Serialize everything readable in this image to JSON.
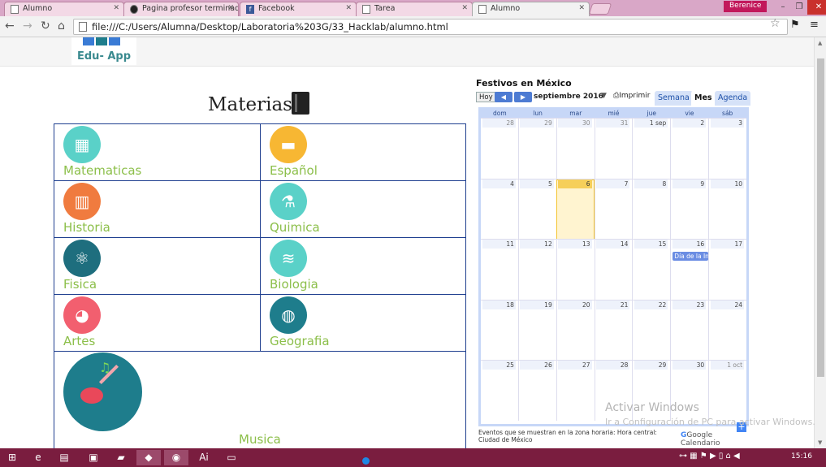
{
  "browser": {
    "tabs": [
      {
        "label": "Alumno",
        "active": false
      },
      {
        "label": "Pagina profesor terminad",
        "active": false
      },
      {
        "label": "Facebook",
        "active": false
      },
      {
        "label": "Tarea",
        "active": false
      },
      {
        "label": "Alumno",
        "active": true
      }
    ],
    "user": "Berenice",
    "url": "file:///C:/Users/Alumna/Desktop/Laboratoria%203G/33_Hacklab/alumno.html"
  },
  "header": {
    "logo_text": "Edu- App"
  },
  "materias": {
    "title": "Materias",
    "items": [
      {
        "label": "Matematicas",
        "icon": "calculator-icon",
        "color": "#5ad1c8",
        "symbol": "▦"
      },
      {
        "label": "Español",
        "icon": "book-stack-icon",
        "color": "#f7b733",
        "symbol": "▬"
      },
      {
        "label": "Historia",
        "icon": "column-icon",
        "color": "#f07b3f",
        "symbol": "▥"
      },
      {
        "label": "Quimica",
        "icon": "flask-icon",
        "color": "#5ad1c8",
        "symbol": "⚗"
      },
      {
        "label": "Fisica",
        "icon": "atom-icon",
        "color": "#1e6e7e",
        "symbol": "⚛"
      },
      {
        "label": "Biologia",
        "icon": "dna-icon",
        "color": "#5ad1c8",
        "symbol": "≋"
      },
      {
        "label": "Artes",
        "icon": "palette-icon",
        "color": "#f25f6f",
        "symbol": "◕"
      },
      {
        "label": "Geografia",
        "icon": "globe-icon",
        "color": "#1e7d8c",
        "symbol": "◍"
      }
    ],
    "music": {
      "label": "Musica",
      "icon": "guitar-icon",
      "note": "♫"
    }
  },
  "calendar": {
    "title": "Festivos en México",
    "today_btn": "Hoy",
    "prev": "◀",
    "next": "▶",
    "month_label": "septiembre 2016",
    "print_label": "Imprimir",
    "views": [
      "Semana",
      "Mes",
      "Agenda"
    ],
    "selected_view": "Mes",
    "weekdays": [
      "dom",
      "lun",
      "mar",
      "mié",
      "jue",
      "vie",
      "sáb"
    ],
    "weeks": [
      [
        "28",
        "29",
        "30",
        "31",
        "1 sep",
        "2",
        "3"
      ],
      [
        "4",
        "5",
        "6",
        "7",
        "8",
        "9",
        "10"
      ],
      [
        "11",
        "12",
        "13",
        "14",
        "15",
        "16",
        "17"
      ],
      [
        "18",
        "19",
        "20",
        "21",
        "22",
        "23",
        "24"
      ],
      [
        "25",
        "26",
        "27",
        "28",
        "29",
        "30",
        "1 oct"
      ]
    ],
    "today": "6",
    "event": {
      "date": "16",
      "label": "Día de la Independencia"
    },
    "footer": "Eventos que se muestran en la zona horaria: Hora central: Ciudad de México",
    "powered": "Google Calendario"
  },
  "watermark": {
    "line1": "Activar Windows",
    "line2": "Ir a Configuración de PC para activar Windows."
  },
  "taskbar": {
    "time": "15:16"
  }
}
